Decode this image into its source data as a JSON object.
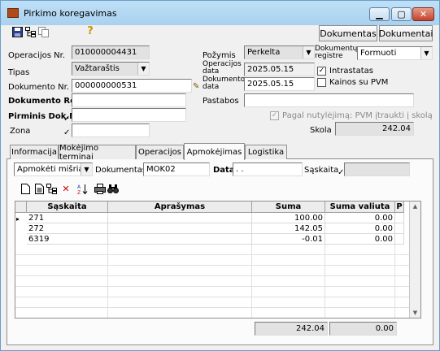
{
  "window": {
    "title": "Pirkimo koregavimas"
  },
  "toolbar": {
    "icons": [
      "save-icon",
      "tree-icon",
      "copy-icon",
      "help-icon"
    ],
    "btn_documents": "Dokumentas",
    "btn_documents2": "Dokumentai"
  },
  "form": {
    "op_nr_label": "Operacijos Nr.",
    "op_nr": "010000004431",
    "tipas_label": "Tipas",
    "tipas": "Važtaraštis",
    "dok_nr_label": "Dokumento Nr.",
    "dok_nr": "000000000531",
    "dok_reg_label": "Dokumento Reg.",
    "dok_reg": "",
    "pirminis_label": "Pirminis Dok.Nr.",
    "pirminis": "",
    "zona_label": "Zona",
    "zona": "",
    "pozymis_label": "Požymis",
    "pozymis": "Perkelta",
    "op_data_label1": "Operacijos",
    "op_data_label2": "data",
    "op_data": "2025.05.15",
    "dok_data_label1": "Dokumento",
    "dok_data_label2": "data",
    "dok_data": "2025.05.15",
    "registre_label1": "Dokumentų",
    "registre_label2": "registre",
    "registre": "Formuoti",
    "intrastatas_label": "Intrastatas",
    "intrastatas_checked": true,
    "kainos_label": "Kainos su PVM",
    "kainos_checked": false,
    "pastabos_label": "Pastabos",
    "pastabos": "",
    "pagal_label": "Pagal nutylėjimą: PVM įtraukti į skolą",
    "pagal_checked": true,
    "skola_label": "Skola",
    "skola": "242.04"
  },
  "tabs": [
    {
      "label": "Informacija",
      "active": false
    },
    {
      "label": "Mokėjimo terminai",
      "active": false
    },
    {
      "label": "Operacijos",
      "active": false
    },
    {
      "label": "Apmokėjimas",
      "active": true
    },
    {
      "label": "Logistika",
      "active": false
    }
  ],
  "payment": {
    "mode": "Apmokėti mišriai",
    "dokumentas_label": "Dokumentas",
    "dokumentas": "MOK02",
    "data_label": "Data",
    "data": " . .",
    "saskaita_label": "Sąskaita",
    "saskaita": ""
  },
  "grid_toolbar": {
    "icons": [
      "new-document-icon",
      "document-icon",
      "tree-icon",
      "delete-icon",
      "sort-icon",
      "print-icon",
      "find-icon"
    ]
  },
  "grid": {
    "columns": [
      "Sąskaita",
      "Aprašymas",
      "Suma",
      "Suma valiuta",
      "P"
    ],
    "rows": [
      {
        "saskaita": "271",
        "aprasymas": "",
        "suma": "100.00",
        "valiuta": "0.00",
        "p": ""
      },
      {
        "saskaita": "272",
        "aprasymas": "",
        "suma": "142.05",
        "valiuta": "0.00",
        "p": ""
      },
      {
        "saskaita": "6319",
        "aprasymas": "",
        "suma": "-0.01",
        "valiuta": "0.00",
        "p": ""
      }
    ],
    "total_suma": "242.04",
    "total_valiuta": "0.00"
  }
}
